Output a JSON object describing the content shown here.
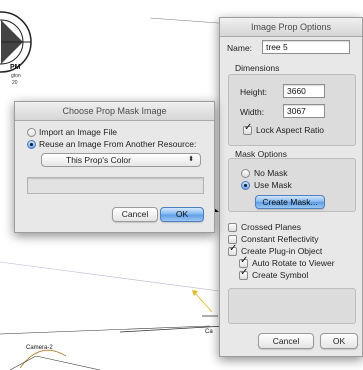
{
  "background": {
    "label_pm": "PM",
    "label_sub1": "gton",
    "label_sub2": "20",
    "label_camera": "Camera-2",
    "label_ca": "Ca"
  },
  "prop_options": {
    "title": "Image Prop Options",
    "name_label": "Name:",
    "name_value": "tree 5",
    "dimensions_label": "Dimensions",
    "height_label": "Height:",
    "height_value": "3660",
    "width_label": "Width:",
    "width_value": "3067",
    "lock_aspect_label": "Lock Aspect Ratio",
    "lock_aspect_checked": true,
    "mask_options_label": "Mask Options",
    "no_mask_label": "No Mask",
    "use_mask_label": "Use Mask",
    "selected_mask": "Use Mask",
    "create_mask_label": "Create Mask...",
    "crossed_planes_label": "Crossed Planes",
    "constant_reflectivity_label": "Constant Reflectivity",
    "create_plugin_label": "Create Plug-in Object",
    "auto_rotate_label": "Auto Rotate to Viewer",
    "create_symbol_label": "Create Symbol",
    "crossed_planes_checked": false,
    "constant_reflectivity_checked": false,
    "create_plugin_checked": true,
    "auto_rotate_checked": true,
    "create_symbol_checked": true,
    "cancel_label": "Cancel",
    "ok_label": "OK"
  },
  "mask_dialog": {
    "title": "Choose Prop Mask Image",
    "import_label": "Import an Image File",
    "reuse_label": "Reuse an Image From Another Resource:",
    "selected_option": "Reuse an Image From Another Resource:",
    "resource_popup_value": "This Prop's Color",
    "resource_name_value": "",
    "cancel_label": "Cancel",
    "ok_label": "OK"
  },
  "colors": {
    "default_button": "#5a9be6",
    "window_bg": "#e8e8e8"
  }
}
